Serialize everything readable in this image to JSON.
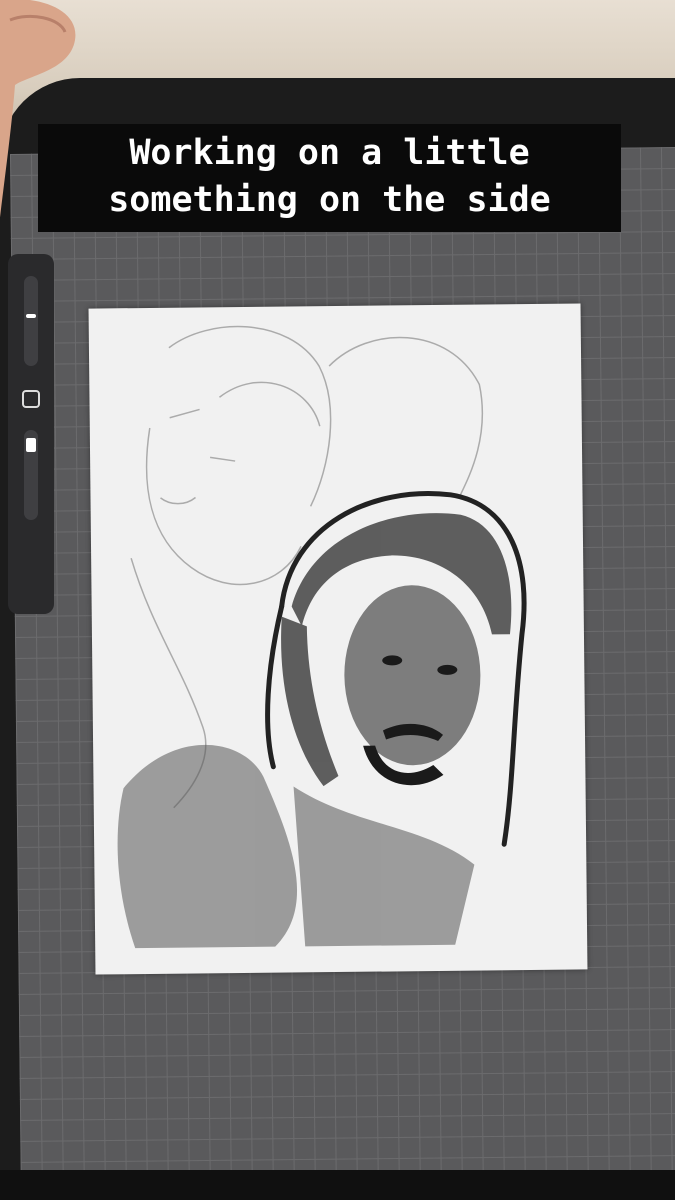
{
  "caption": {
    "line1": "Working on a little",
    "line2": "something on the side"
  },
  "icons": [
    "brush-size-slider-icon",
    "modify-square-icon",
    "opacity-slider-icon",
    "hand-icon",
    "sketch-portrait-icon"
  ],
  "colors": {
    "caption_bg": "#0a0a0a",
    "caption_text": "#ffffff",
    "grid_bg": "#5a5a5c",
    "canvas": "#f1f1f1"
  }
}
